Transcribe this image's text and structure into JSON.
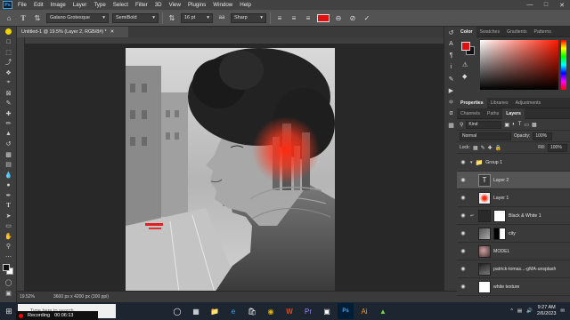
{
  "menu": {
    "logo": "Ps",
    "items": [
      "File",
      "Edit",
      "Image",
      "Layer",
      "Type",
      "Select",
      "Filter",
      "3D",
      "View",
      "Plugins",
      "Window",
      "Help"
    ],
    "window_controls": [
      "minimize-icon",
      "maximize-icon",
      "close-icon"
    ]
  },
  "options": {
    "font_family": "Galano Grotesque",
    "font_style": "SemiBold",
    "font_size": "16 pt",
    "anti_alias": "Sharp",
    "text_color": "#e01010"
  },
  "document": {
    "tab_title": "Untitled-1 @ 19.5% (Layer 2, RGB/8#) *",
    "zoom": "19.52%",
    "info": "3600 px x 4200 px (300 ppi)"
  },
  "color_panel": {
    "tabs": [
      "Color",
      "Swatches",
      "Gradients",
      "Patterns"
    ],
    "foreground": "#e01010",
    "background": "#111111"
  },
  "properties_panel": {
    "tabs": [
      "Properties",
      "Libraries",
      "Adjustments"
    ]
  },
  "layers_panel": {
    "tabs": [
      "Channels",
      "Paths",
      "Layers"
    ],
    "kind_filter": "Kind",
    "blend_mode": "Normal",
    "opacity_label": "Opacity:",
    "opacity_value": "100%",
    "lock_label": "Lock:",
    "fill_label": "Fill:",
    "fill_value": "100%",
    "layers": [
      {
        "name": "Group 1",
        "kind": "group",
        "selected": false
      },
      {
        "name": "Layer 2",
        "kind": "text",
        "selected": true
      },
      {
        "name": "Layer 1",
        "kind": "red",
        "selected": false
      },
      {
        "name": "Black & White 1",
        "kind": "adjust",
        "selected": false
      },
      {
        "name": "city",
        "kind": "city",
        "selected": false
      },
      {
        "name": "MODEL",
        "kind": "model",
        "selected": false
      },
      {
        "name": "patrick-tomas...-gMA-unsplash",
        "kind": "photo",
        "selected": false
      },
      {
        "name": "white texture",
        "kind": "white",
        "selected": false
      }
    ]
  },
  "taskbar": {
    "search_placeholder": "Type here to search",
    "recording_label": "Recording",
    "recording_time": "00:06:13",
    "time": "9:27 AM",
    "date": "2/6/2023"
  }
}
